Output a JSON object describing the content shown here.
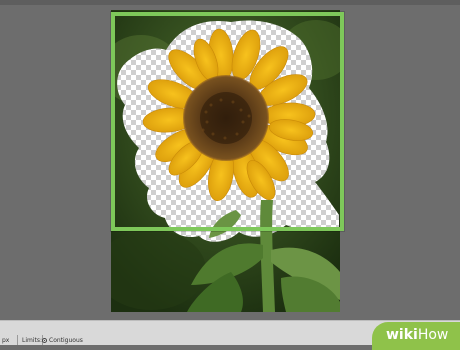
{
  "status_bar": {
    "left_text": "px",
    "limits_label": "Limits:",
    "contiguous_label": "Contiguous"
  },
  "watermark": {
    "part1": "wiki",
    "part2": "How"
  },
  "colors": {
    "workspace_background": "#6d6d6d",
    "selection_frame": "#7ec85a",
    "watermark_green": "#8fc24a"
  },
  "canvas": {
    "image_subject": "sunflower",
    "transparency_pattern": "checkerboard"
  }
}
